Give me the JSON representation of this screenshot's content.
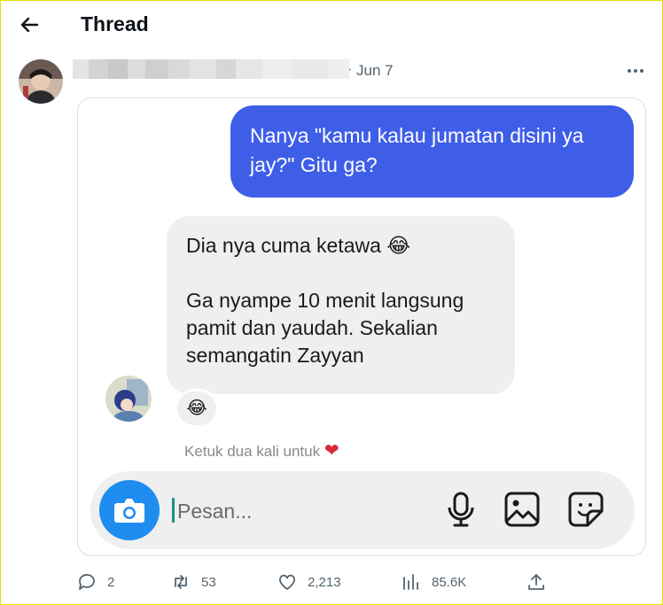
{
  "header": {
    "title": "Thread",
    "back_icon": "arrow-left-icon"
  },
  "post": {
    "separator": "·",
    "date": "Jun 7",
    "more_icon": "more-icon"
  },
  "chat": {
    "outgoing_message": "Nanya \"kamu kalau jumatan disini ya jay?\" Gitu ga?",
    "incoming_message": "Dia nya cuma ketawa 😂\n\nGa nyampe 10 menit langsung pamit dan yaudah. Sekalian semangatin Zayyan",
    "reaction": "😂",
    "hint": "Ketuk dua kali untuk",
    "hint_heart": "❤",
    "composer_placeholder": "Pesan...",
    "colors": {
      "outgoing_bubble": "#3f5ee8",
      "incoming_bubble": "#efefef",
      "camera_button": "#1f8cf0"
    }
  },
  "actions": {
    "replies": "2",
    "reposts": "53",
    "likes": "2,213",
    "views": "85.6K"
  }
}
